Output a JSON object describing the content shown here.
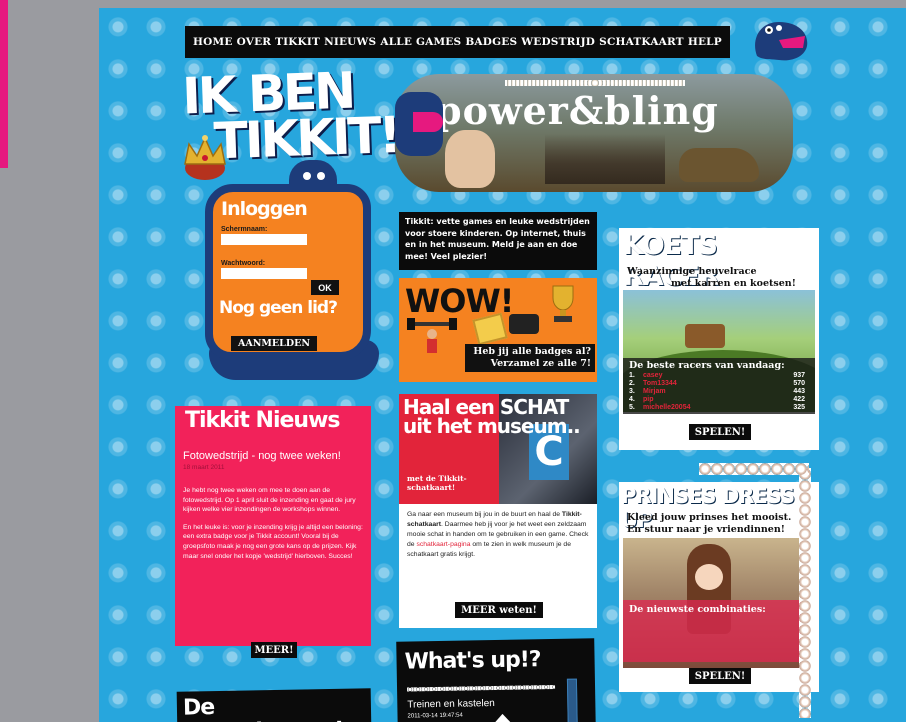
{
  "nav": {
    "items": [
      "HOME",
      "OVER TIKKIT",
      "NIEUWS",
      "ALLE GAMES",
      "BADGES",
      "WEDSTRIJD",
      "SCHATKAART",
      "HELP"
    ]
  },
  "hero": {
    "line1": "IK BEN",
    "line2": "TIKKIT!"
  },
  "login": {
    "title": "Inloggen",
    "username_label": "Schermnaam:",
    "password_label": "Wachtwoord:",
    "ok_label": "OK",
    "no_member": "Nog geen lid?",
    "register_label": "AANMELDEN"
  },
  "power": {
    "title": "power&bling"
  },
  "intro": {
    "text": "Tikkit: vette games en leuke wedstrijden voor stoere kinderen. Op internet, thuis en in het museum. Meld je aan en doe mee! Veel plezier!"
  },
  "badges": {
    "title": "WOW!",
    "caption_line1": "Heb jij alle badges al?",
    "caption_line2": "Verzamel ze alle 7!"
  },
  "news": {
    "title": "Tikkit Nieuws",
    "item_title": "Fotowedstrijd - nog twee weken!",
    "item_date": "18 maart 2011",
    "para1": "Je hebt nog twee weken om mee te doen aan de fotowedstrijd. Op 1 april sluit de inzending en gaat de jury kijken welke vier inzendingen de workshops winnen.",
    "para2": "En het leuke is: voor je inzending krijg je altijd een beloning: een extra badge voor je Tikkit account! Vooral bij de groepsfoto maak je nog een grote kans op de prijzen. Kijk maar snel onder het kopje 'wedstrijd' hierboven. Succes!",
    "more_label": "MEER!"
  },
  "schat": {
    "title": "Haal een SCHAT uit het museum..",
    "subtitle": "met de Tikkit-schatkaart!",
    "body_a": "Ga naar een museum bij jou in de buurt en haal de ",
    "body_bold": "Tikkit-schatkaart",
    "body_b": ". Daarmee heb jij voor je het weet een zeldzaam mooie schat in handen om te gebruiken in een game. Check de ",
    "body_link": "schatkaart-pagina",
    "body_c": " om te zien in welk museum je de schatkaart gratis krijgt.",
    "more_label": "MEER weten!",
    "icon_letter": "C"
  },
  "whatsup": {
    "title": "What's up!?",
    "item_title": "Treinen en kastelen",
    "item_date": "2011-03-14 19:47:54"
  },
  "allerbesten": {
    "title": "De ALLERbesten!"
  },
  "koets": {
    "title": "KOETS RACER",
    "tag_line1": "Waanzinnige heuvelrace",
    "tag_line2": "met karren en koetsen!",
    "scores_header": "De beste racers van vandaag:",
    "scores": [
      {
        "rank": "1.",
        "name": "casey",
        "score": "937"
      },
      {
        "rank": "2.",
        "name": "Tom13344",
        "score": "570"
      },
      {
        "rank": "3.",
        "name": "Mirjam",
        "score": "443"
      },
      {
        "rank": "4.",
        "name": "pip",
        "score": "422"
      },
      {
        "rank": "5.",
        "name": "michelle20054",
        "score": "325"
      }
    ],
    "play_label": "SPELEN!"
  },
  "prinses": {
    "title": "PRINSES DRESS UP",
    "tag_line1": "Kleed jouw prinses het mooist.",
    "tag_line2": "En stuur naar je vriendinnen!",
    "band_label": "De nieuwste combinaties:",
    "play_label": "SPELEN!"
  },
  "colors": {
    "background": "#27a6dd",
    "accent_pink": "#e6197f",
    "orange": "#f58220",
    "red": "#f2225a",
    "navy": "#1d3c7a"
  }
}
